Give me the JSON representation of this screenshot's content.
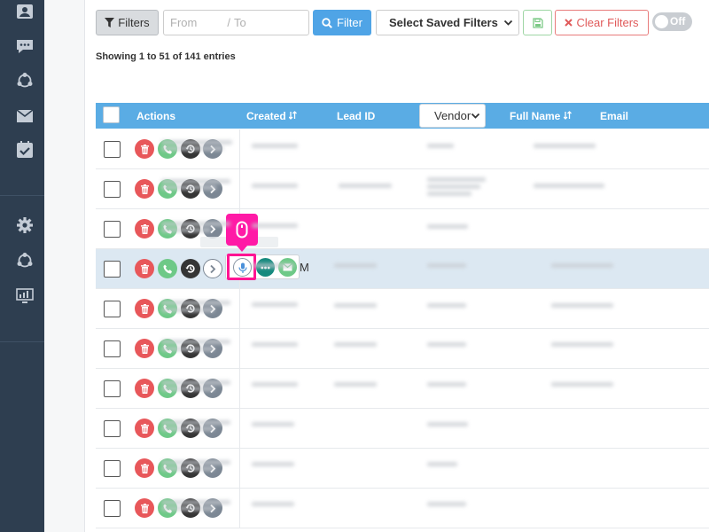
{
  "sidebar": {
    "icons": [
      "contacts-icon",
      "chat-icon",
      "share-network-icon",
      "mail-icon",
      "tasks-check-icon",
      "settings-gear-icon",
      "integrations-network-icon",
      "reports-monitor-icon"
    ]
  },
  "toolbar": {
    "filters_label": "Filters",
    "date_from_placeholder": "From",
    "date_separator": "/",
    "date_to_placeholder": "To",
    "filter_button_label": "Filter",
    "saved_filters_value": "Select Saved Filters",
    "clear_filters_label": "Clear Filters",
    "toggle_label": "Off"
  },
  "entries_info": {
    "prefix": "Showing 1 to 51 of",
    "total": "141",
    "suffix": "entries"
  },
  "table": {
    "columns": {
      "actions": "Actions",
      "created": "Created",
      "lead_id": "Lead ID",
      "vendor_select": "Vendor",
      "full_name": "Full Name",
      "email": "Email"
    },
    "row_count": 10,
    "highlighted_row": 4,
    "popover_overflow_text": "M"
  },
  "colors": {
    "sidebar_bg": "#2e3e50",
    "header_bg": "#5aace4",
    "filter_button": "#4fa4e6",
    "delete_action": "#e8575a",
    "call_action": "#6ec987",
    "history_action": "#353535",
    "more_action": "#7c8794",
    "highlight": "#ff1493",
    "selected_row": "#dce8f2"
  }
}
